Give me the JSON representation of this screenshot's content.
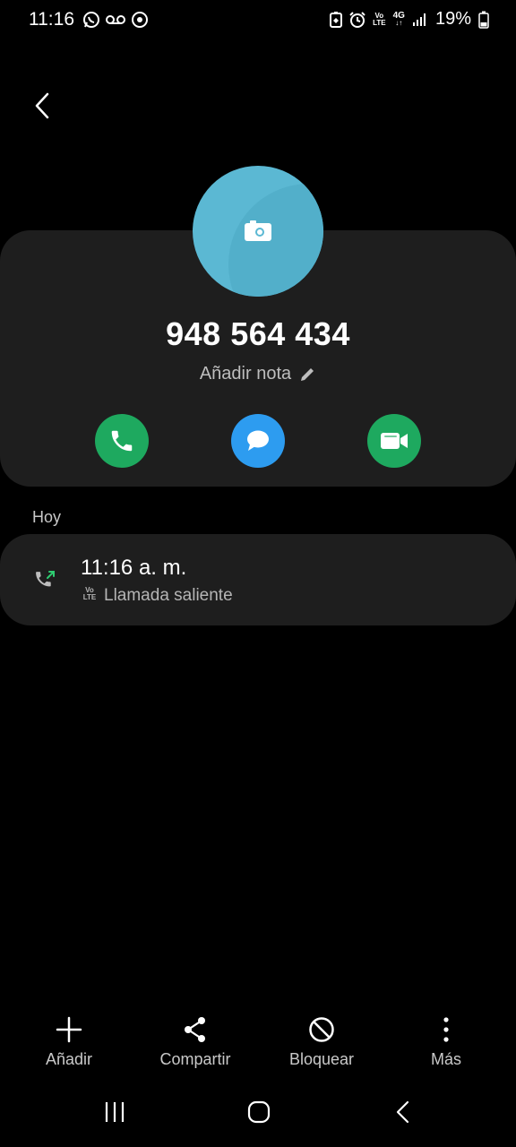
{
  "status_bar": {
    "time": "11:16",
    "battery": "19%",
    "volte_top": "Vo",
    "volte_bottom": "LTE",
    "network": "4G"
  },
  "contact": {
    "phone_number": "948 564 434",
    "add_note_label": "Añadir nota",
    "avatar_color": "#5bb8d3"
  },
  "actions": {
    "call_color": "#1ea95f",
    "message_color": "#2d9cf0",
    "video_color": "#1ea95f"
  },
  "history": {
    "section_label": "Hoy",
    "items": [
      {
        "time": "11:16 a. m.",
        "volte_top": "Vo",
        "volte_bottom": "LTE",
        "type": "Llamada saliente",
        "icon": "outgoing-call-icon"
      }
    ]
  },
  "toolbar": {
    "add_label": "Añadir",
    "share_label": "Compartir",
    "block_label": "Bloquear",
    "more_label": "Más"
  }
}
